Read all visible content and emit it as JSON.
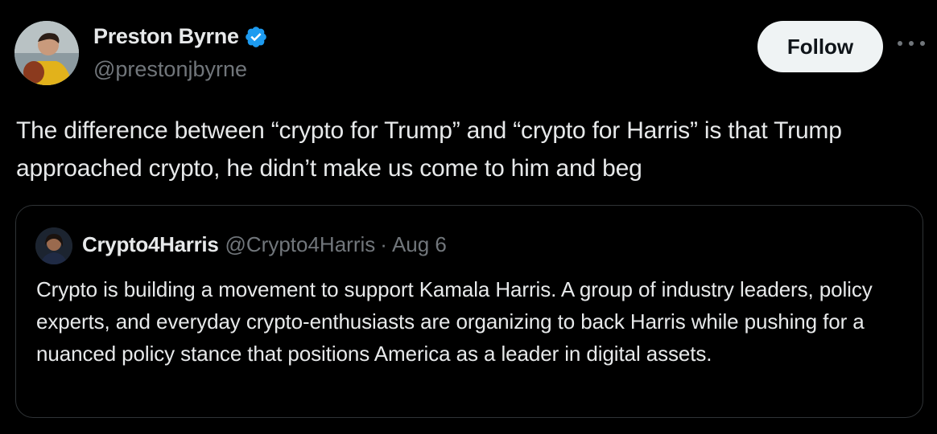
{
  "author": {
    "display_name": "Preston Byrne",
    "handle": "@prestonjbyrne",
    "verified_icon": "verified-badge-icon",
    "avatar_icon": "avatar-photo"
  },
  "actions": {
    "follow_label": "Follow",
    "more_icon": "more-horizontal-icon"
  },
  "tweet": {
    "text": "The difference between “crypto for Trump” and “crypto for Harris” is that Trump approached crypto, he didn’t make us come to him and beg"
  },
  "quoted_tweet": {
    "display_name": "Crypto4Harris",
    "handle": "@Crypto4Harris",
    "separator": "·",
    "date": "Aug 6",
    "text": "Crypto is building a movement to support Kamala Harris. A group of industry leaders, policy experts, and everyday crypto-enthusiasts are organizing to back Harris while pushing for a nuanced policy stance that positions America as a leader in digital assets."
  },
  "colors": {
    "background": "#000000",
    "primary_text": "#e7e9ea",
    "secondary_text": "#71767b",
    "verified_blue": "#1d9bf0",
    "follow_button_bg": "#eff3f4",
    "border": "#2f3336"
  }
}
